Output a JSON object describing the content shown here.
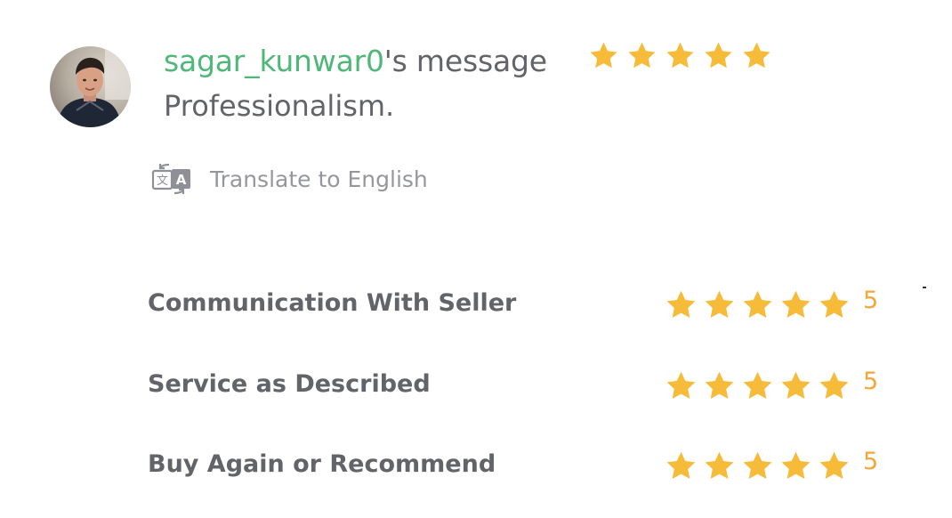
{
  "review": {
    "username": "sagar_kunwar0",
    "username_suffix": "'s message",
    "overall_rating": 5,
    "message": "Professionalism.",
    "translate_label": "Translate to English"
  },
  "ratings": [
    {
      "label": "Communication With Seller",
      "value": "5"
    },
    {
      "label": "Service as Described",
      "value": "5"
    },
    {
      "label": "Buy Again or Recommend",
      "value": "5"
    }
  ],
  "colors": {
    "username": "#4fb778",
    "text": "#62646a",
    "muted": "#95979d",
    "star": "#f7bb3a",
    "rating_number": "#f2a73b"
  },
  "icons": {
    "avatar": "user-avatar-photo",
    "translate": "translate-icon",
    "star": "star-icon"
  }
}
